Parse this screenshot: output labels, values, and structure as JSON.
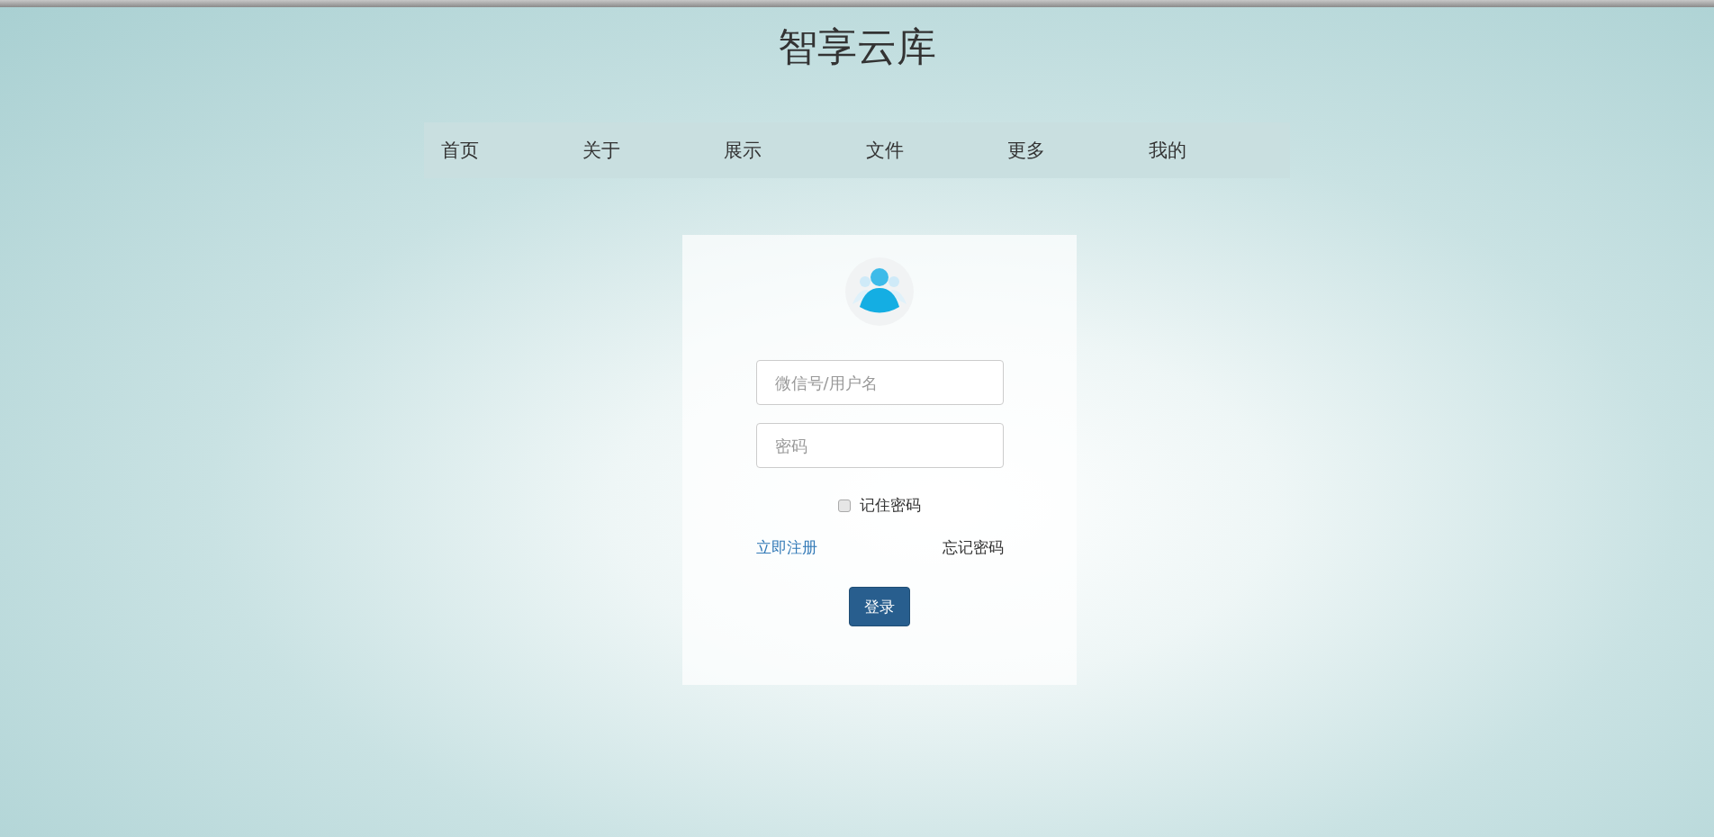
{
  "title": "智享云库",
  "nav": [
    {
      "label": "首页"
    },
    {
      "label": "关于"
    },
    {
      "label": "展示"
    },
    {
      "label": "文件"
    },
    {
      "label": "更多"
    },
    {
      "label": "我的"
    }
  ],
  "login": {
    "username": {
      "placeholder": "微信号/用户名"
    },
    "password": {
      "placeholder": "密码"
    },
    "remember": {
      "label": "记住密码",
      "checked": false
    },
    "register_link": "立即注册",
    "forgot_link": "忘记密码",
    "submit": "登录"
  }
}
